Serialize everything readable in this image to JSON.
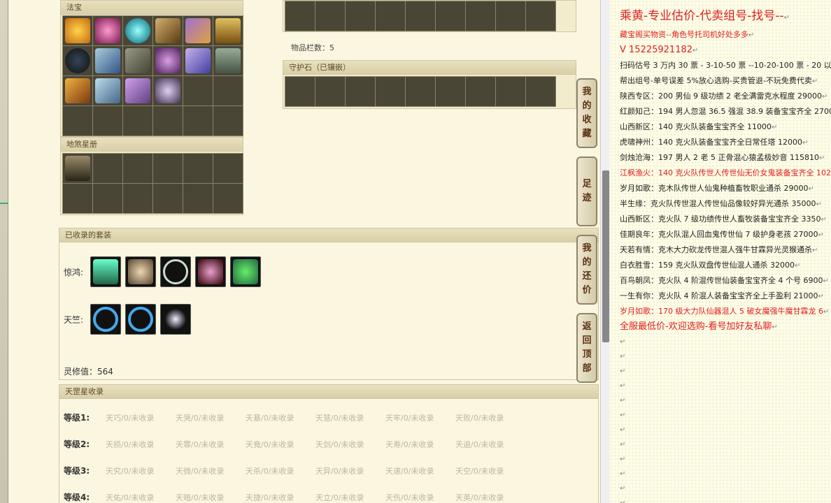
{
  "fabao": {
    "title": "法宝"
  },
  "dishaxingce": {
    "title": "地煞星册"
  },
  "top_bag": {
    "count_label": "物品栏数：5"
  },
  "guardian": {
    "title": "守护石（已镶嵌）"
  },
  "suits": {
    "title": "已收录的套装",
    "rows": [
      {
        "label": "惊鸿:"
      },
      {
        "label": "天竺:"
      }
    ],
    "score": "灵修值：564"
  },
  "tiangang": {
    "title": "天罡星收录",
    "rows": [
      {
        "label": "等级1:",
        "items": [
          "天巧/0/未收录",
          "天哭/0/未收录",
          "天暴/0/未收录",
          "天慧/0/未收录",
          "天牢/0/未收录",
          "天败/0/未收录"
        ]
      },
      {
        "label": "等级2:",
        "items": [
          "天损/0/未收录",
          "天罪/0/未收录",
          "天竟/0/未收录",
          "天剑/0/未收录",
          "天寿/0/未收录",
          "天退/0/未收录"
        ]
      },
      {
        "label": "等级3:",
        "items": [
          "天究/0/未收录",
          "天微/0/未收录",
          "天杀/0/未收录",
          "天异/0/未收录",
          "天速/0/未收录",
          "天空/0/未收录"
        ]
      },
      {
        "label": "等级4:",
        "items": [
          "天佑/0/未收录",
          "天暗/0/未收录",
          "天捷/0/未收录",
          "天立/0/未收录",
          "天伤/0/未收录",
          "天英/0/未收录"
        ]
      }
    ]
  },
  "side_tabs": [
    {
      "chars": [
        "我",
        "的",
        "收",
        "藏"
      ]
    },
    {
      "chars": [
        "足",
        "迹"
      ]
    },
    {
      "chars": [
        "我",
        "的",
        "还",
        "价"
      ]
    },
    {
      "chars": [
        "返",
        "回",
        "顶",
        "部"
      ]
    }
  ],
  "right_panel": {
    "title": "乘黄-专业估价-代卖组号-找号--",
    "lines": [
      {
        "text": "藏宝阁买物资--角色号托司机好处多多",
        "color": "red"
      },
      {
        "text": "V 15225921182",
        "color": "red",
        "big": true
      },
      {
        "text": "扫码估号 3 万内 30 票 - 3-10-50 票  --10-20-100 票 - 20 以上",
        "color": "black"
      },
      {
        "text": "帮出组号-单号误差 5%放心选购-买贵管退-不玩免费代卖",
        "color": "black"
      },
      {
        "text": "陕西专区：200 男仙 9 级功绩 2 老全满雷克水程度 29000",
        "color": "black"
      },
      {
        "text": "红颜知己：194 男人忽混 36.5 强混 38.9 装备宝宝齐全 2700",
        "color": "black"
      },
      {
        "text": "山西新区：140 克火队装备宝宝齐全 11000",
        "color": "black"
      },
      {
        "text": "虎啸神州：140 克火队装备宝宝齐全日常任塔 12000",
        "color": "black"
      },
      {
        "text": "剑烛沧海：197 男人 2 老 5 正骨混心猿孟极妙音 115810",
        "color": "black"
      },
      {
        "text": "江枫渔火：140 克火队传世人传世仙无价女鬼装备宝齐全 102",
        "color": "red"
      },
      {
        "text": "岁月如歌：克木队传世人仙鬼种植畜牧职业通杀 29000",
        "color": "black"
      },
      {
        "text": "半生缘：克火队传世混人传世仙品像较好异光通杀 35000",
        "color": "black"
      },
      {
        "text": "山西新区：克火队 7 级功绩传世人畜牧装备宝宝齐全 3350",
        "color": "black"
      },
      {
        "text": "佳期良年：克火队混人回血鬼传世仙 7 级护身老孩 27000",
        "color": "black"
      },
      {
        "text": "天若有情：克木大力砍龙传世混人强牛甘霖异光灵猴通杀",
        "color": "black"
      },
      {
        "text": "白衣胜雪：159 克火队双盘传世仙混人通杀 32000",
        "color": "black"
      },
      {
        "text": "百鸟朝凤：克火队 4 阶混传世仙装备宝宝齐全 4 个号 6900",
        "color": "black"
      },
      {
        "text": "一生有你：克火队 4 阶混人装备宝宝齐全上手盈利 21000",
        "color": "black"
      },
      {
        "text": "岁月如歌：170 级大力队仙器混人 5 破女魔强牛魔甘霖龙 6",
        "color": "red"
      },
      {
        "text": "全服最低价-欢迎选购-看号加好友私聊",
        "color": "red",
        "big": true
      }
    ],
    "return_mark": "↵"
  }
}
